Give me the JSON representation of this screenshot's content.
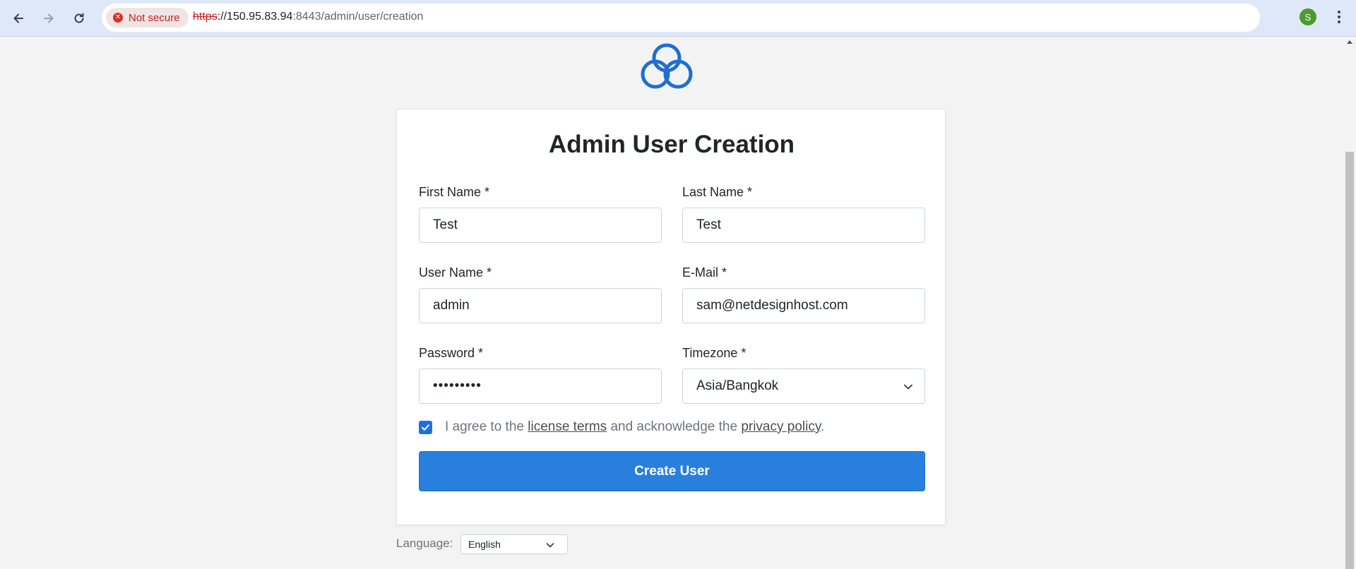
{
  "browser": {
    "security_label": "Not secure",
    "url_scheme": "https",
    "url_host": "://150.95.83.94",
    "url_path": ":8443/admin/user/creation",
    "profile_initial": "S"
  },
  "form": {
    "title": "Admin User Creation",
    "first_name": {
      "label": "First Name *",
      "value": "Test"
    },
    "last_name": {
      "label": "Last Name *",
      "value": "Test"
    },
    "user_name": {
      "label": "User Name *",
      "value": "admin"
    },
    "email": {
      "label": "E-Mail *",
      "value": "sam@netdesignhost.com"
    },
    "password": {
      "label": "Password *",
      "value": "•••••••••"
    },
    "timezone": {
      "label": "Timezone *",
      "value": "Asia/Bangkok"
    },
    "agree": {
      "text_before": "I agree to the ",
      "license_link": "license terms",
      "text_middle": " and acknowledge the ",
      "privacy_link": "privacy policy",
      "text_after": ".",
      "checked": true
    },
    "submit_label": "Create User"
  },
  "language": {
    "label": "Language:",
    "selected": "English"
  },
  "colors": {
    "accent": "#287fdd",
    "logo": "#1f6fce",
    "warning": "#d93025"
  }
}
